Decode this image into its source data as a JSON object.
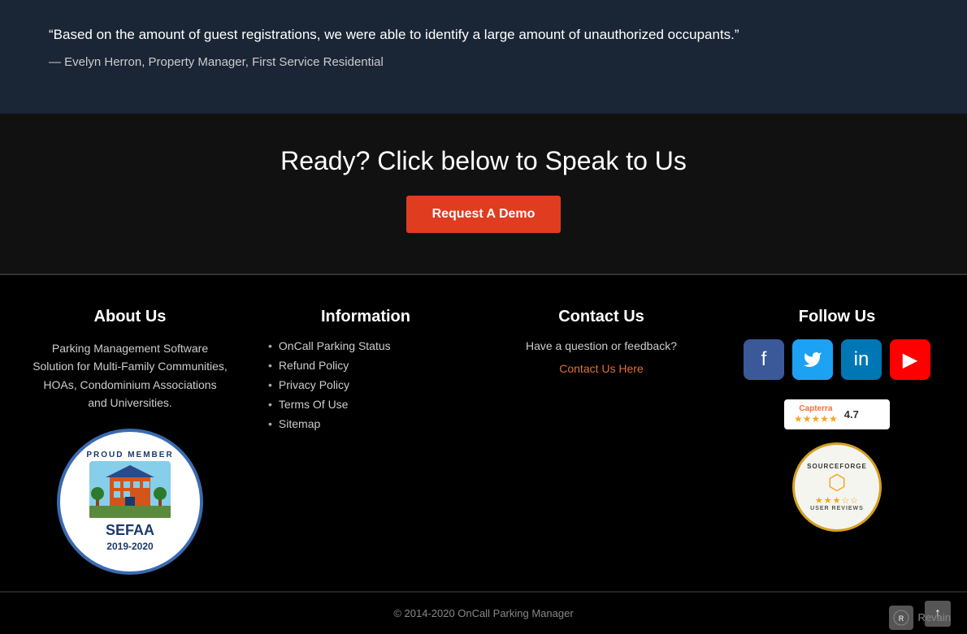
{
  "quote": {
    "text": "“Based on the amount of guest registrations, we were able to identify a large amount of unauthorized occupants.”",
    "author": "— Evelyn Herron, Property Manager, First Service Residential"
  },
  "cta": {
    "title": "Ready? Click below to Speak to Us",
    "button_label": "Request A Demo"
  },
  "footer": {
    "about": {
      "title": "About Us",
      "description": "Parking Management Software Solution for Multi-Family Communities, HOAs, Condominium Associations and Universities.",
      "badge_alt": "SEFAA Proud Member 2019-2020"
    },
    "information": {
      "title": "Information",
      "links": [
        "OnCall Parking Status",
        "Refund Policy",
        "Privacy Policy",
        "Terms Of Use",
        "Sitemap"
      ]
    },
    "contact": {
      "title": "Contact Us",
      "subtitle": "Have a question or feedback?",
      "link_text": "Contact Us Here"
    },
    "follow": {
      "title": "Follow Us",
      "capterra_score": "4.7",
      "capterra_label": "Capterra",
      "sf_label": "SourceForge",
      "sf_sub": "User Reviews"
    },
    "copyright": "© 2014-2020 OnCall Parking Manager"
  },
  "social": {
    "facebook_label": "f",
    "twitter_label": "🐦",
    "linkedin_label": "in",
    "youtube_label": "▶"
  },
  "scroll_top": "↑",
  "revain_label": "Revain"
}
